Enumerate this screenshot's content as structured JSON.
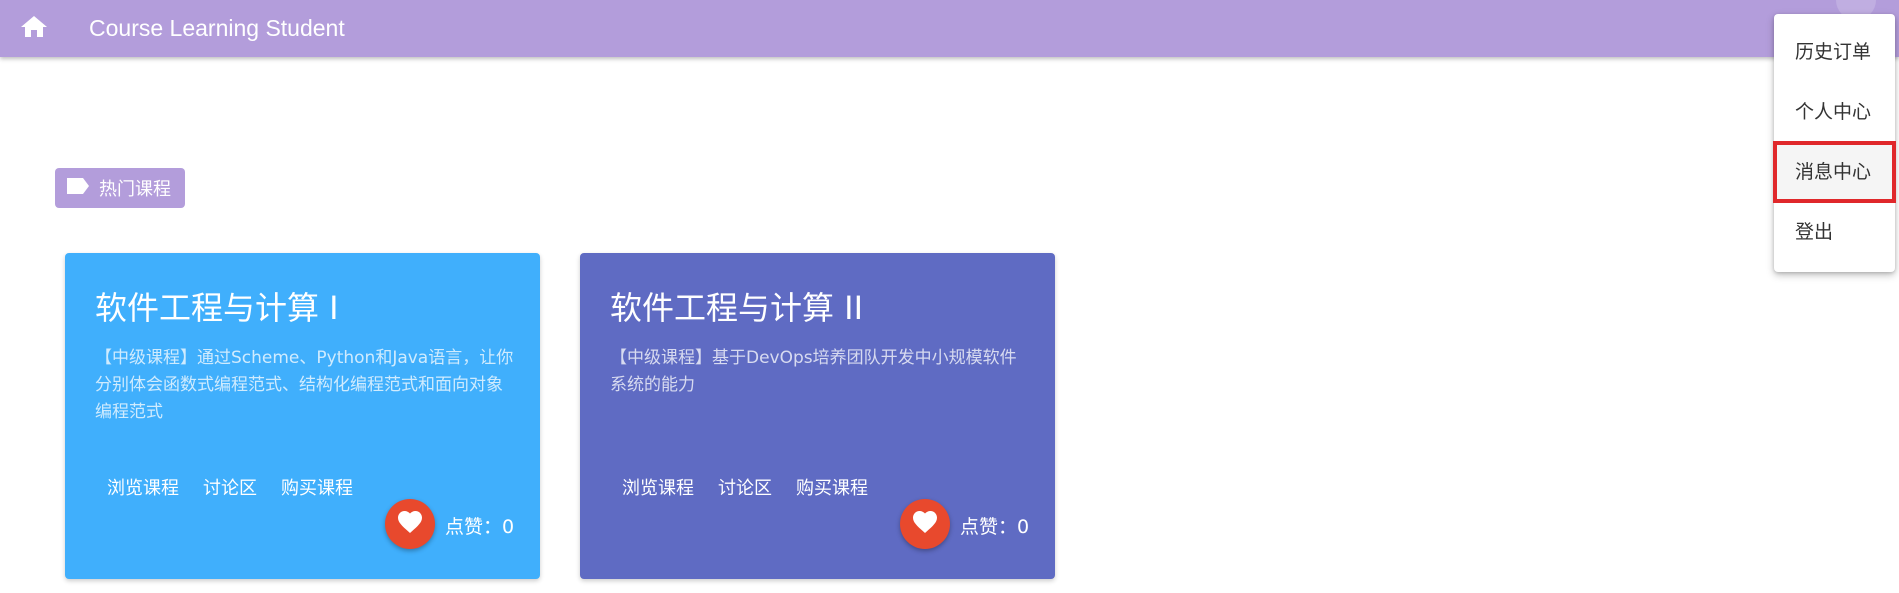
{
  "header": {
    "home_icon": "home-icon",
    "title": "Course Learning Student"
  },
  "menu": {
    "items": [
      {
        "label": "历史订单"
      },
      {
        "label": "个人中心"
      },
      {
        "label": "消息中心",
        "highlighted": true
      },
      {
        "label": "登出"
      }
    ],
    "highlight_color": "#e0282b"
  },
  "section": {
    "tag_icon": "label-icon",
    "tag_label": "热门课程"
  },
  "courses": [
    {
      "title": "软件工程与计算 I",
      "description": "【中级课程】通过Scheme、Python和Java语言，让你分别体会函数式编程范式、结构化编程范式和面向对象编程范式",
      "actions": [
        "浏览课程",
        "讨论区",
        "购买课程"
      ],
      "likes_label": "点赞：",
      "likes": "0",
      "color": "#40affc"
    },
    {
      "title": "软件工程与计算 II",
      "description": "【中级课程】基于DevOps培养团队开发中小规模软件系统的能力",
      "actions": [
        "浏览课程",
        "讨论区",
        "购买课程"
      ],
      "likes_label": "点赞：",
      "likes": "0",
      "color": "#5f6bc3"
    }
  ],
  "colors": {
    "header": "#b39ddb",
    "like_button": "#e8492d"
  }
}
